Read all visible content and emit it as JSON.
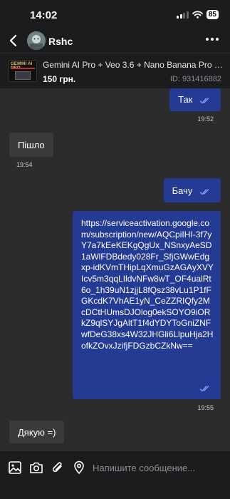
{
  "status": {
    "time": "14:02",
    "battery": "85"
  },
  "header": {
    "contact_name": "Rshc"
  },
  "product": {
    "thumb_label": "GEMINI AI PRO",
    "title": "Gemini AI Pro + Veo 3.6 + Nano Banana Pro +...",
    "price": "150 грн.",
    "id": "ID: 931416882"
  },
  "messages": [
    {
      "direction": "out",
      "text": "Так",
      "time": "19:52"
    },
    {
      "direction": "in",
      "text": "Пішло",
      "time": "19:54"
    },
    {
      "direction": "out",
      "text": "Бачу",
      "time": ""
    },
    {
      "direction": "out",
      "text": "https://serviceactivation.google.com/subscription/new/AQCpiIHI-3f7yY7a7kEeKEKgQgUx_NSnxyAeSD1aWlFDBdedy028Fr_SfjGWwEdgxp-idKVmTHipLqXmuGzAGAyXVYIcv5m3qqLIldvNFw8wT_OF4ualRt6o_1h39uN1zjjL8fQsz38vLu1P1fFGKcdK7VhAE1yN_CeZZRIQfy2McDCtHUmsDJOlog0ekSOYO9iORkZ9qlSYJgAltT1f4dYDYToGniZNFwfDeG38xs4W32JHGli6LlpuHja2HofkZOvxJzifjFDGzbCZkNw==",
      "time": "19:55"
    },
    {
      "direction": "in",
      "text": "Дякую =)",
      "time": ""
    }
  ],
  "input": {
    "placeholder": "Напишите сообщение..."
  },
  "colors": {
    "outgoing_bubble": "#253a93",
    "incoming_bubble": "#3a3a3c",
    "chat_background": "#2c2c2e",
    "read_ticks": "#7f97ff"
  }
}
